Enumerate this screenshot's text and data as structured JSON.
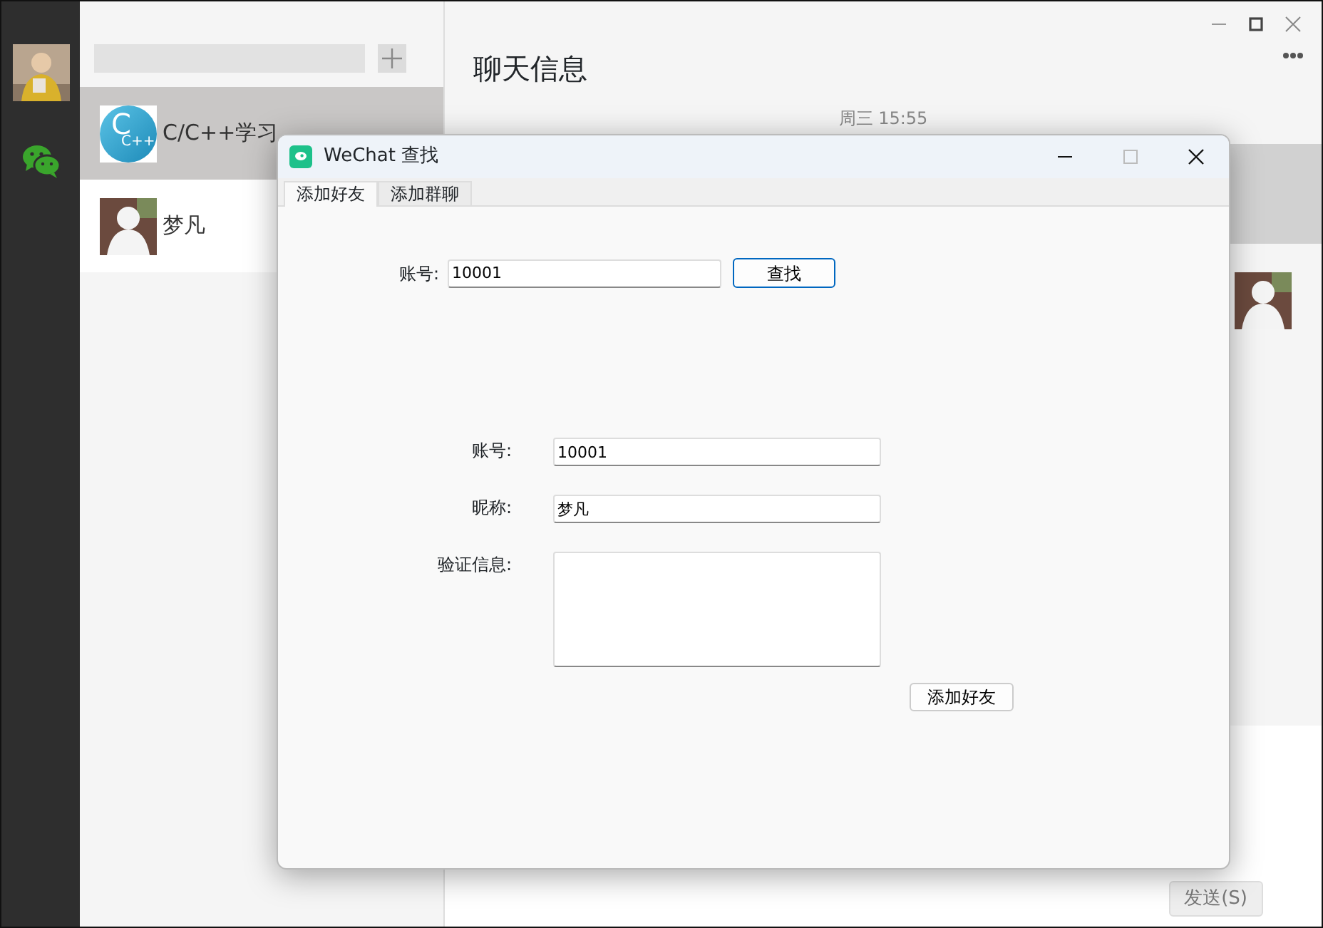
{
  "sidebar": {
    "chats_tab_selected": true
  },
  "contacts": [
    {
      "name": "C/C++学习",
      "kind": "logo",
      "logo_text": "C",
      "logo_subtext": "C++",
      "selected": true
    },
    {
      "name": "梦凡",
      "kind": "figure",
      "selected": false
    }
  ],
  "chat": {
    "title": "聊天信息",
    "timestamp": "周三 15:55",
    "send_button": "发送(S)"
  },
  "dialog": {
    "title": "WeChat 查找",
    "tabs": [
      {
        "label": "添加好友",
        "selected": true
      },
      {
        "label": "添加群聊",
        "selected": false
      }
    ],
    "search": {
      "label": "账号:",
      "value": "10001",
      "button": "查找"
    },
    "fields": [
      {
        "label": "账号:",
        "value": "10001",
        "kind": "line"
      },
      {
        "label": "昵称:",
        "value": "梦凡",
        "kind": "line"
      },
      {
        "label": "验证信息:",
        "kind": "area"
      }
    ],
    "submit": "添加好友"
  }
}
